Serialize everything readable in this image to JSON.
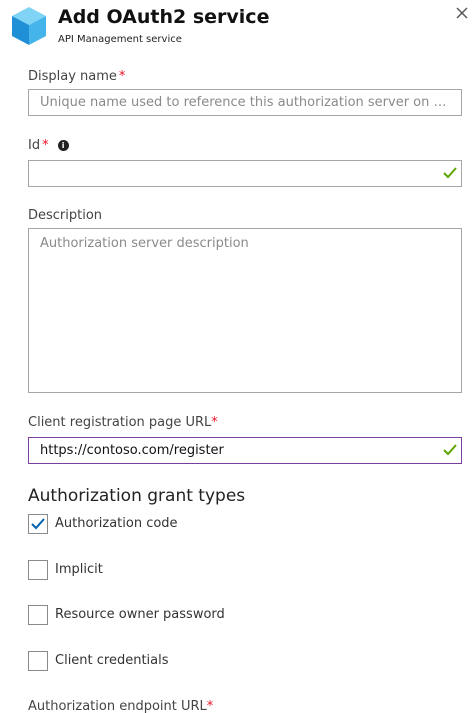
{
  "header": {
    "title": "Add OAuth2 service",
    "subtitle": "API Management service",
    "logo_icon": "cube-icon",
    "close_icon": "close-icon"
  },
  "form": {
    "display_name": {
      "label": "Display name",
      "required_mark": "*",
      "placeholder": "Unique name used to reference this authorization server on t...",
      "value": ""
    },
    "id": {
      "label": "Id",
      "required_mark": "*",
      "info_icon": "info-icon",
      "value": "",
      "valid": true
    },
    "description": {
      "label": "Description",
      "placeholder": "Authorization server description",
      "value": ""
    },
    "client_registration_url": {
      "label": "Client registration page URL",
      "required_mark": "*",
      "value": "https://contoso.com/register",
      "valid": true
    },
    "grant_types": {
      "title": "Authorization grant types",
      "options": [
        {
          "label": "Authorization code",
          "checked": true
        },
        {
          "label": "Implicit",
          "checked": false
        },
        {
          "label": "Resource owner password",
          "checked": false
        },
        {
          "label": "Client credentials",
          "checked": false
        }
      ]
    },
    "authorization_endpoint": {
      "label": "Authorization endpoint URL",
      "required_mark": "*"
    }
  },
  "colors": {
    "accent_check": "#5ea500",
    "focus_border": "#7a3e9d",
    "checkbox_tick": "#0063b1",
    "required": "#e81123"
  }
}
